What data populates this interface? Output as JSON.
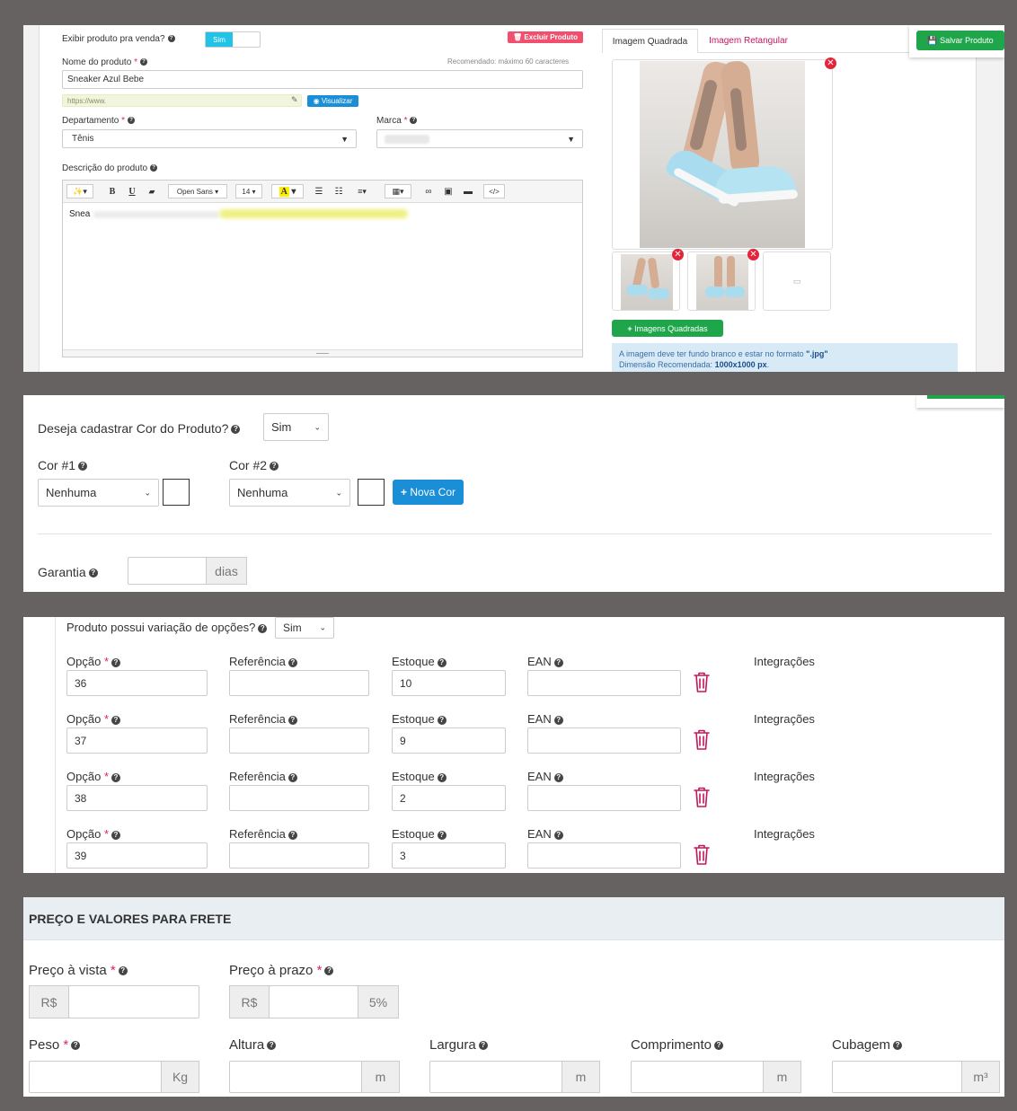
{
  "top": {
    "exibir_label": "Exibir produto pra venda?",
    "exibir_toggle": "Sim",
    "excluir_button": "Excluir Produto",
    "nome_label": "Nome do produto",
    "nome_hint": "Recomendado: máximo 60 caracteres",
    "nome_value": "Sneaker Azul Bebe",
    "url_value": "https://www.",
    "visualizar_button": "Visualizar",
    "departamento_label": "Departamento",
    "departamento_value": "Tênis",
    "marca_label": "Marca",
    "descricao_label": "Descrição do produto",
    "editor": {
      "font_name": "Open Sans",
      "font_size": "14",
      "content": "Snea"
    },
    "tabs": [
      "Imagem Quadrada",
      "Imagem Retangular"
    ],
    "salvar_button": "Salvar Produto",
    "add_images_button": "Imagens Quadradas",
    "info_text_1": "A imagem deve ter fundo branco e estar no formato ",
    "info_format": "\".jpg\"",
    "info_text_2": "Dimensão Recomendada: ",
    "info_dimension": "1000x1000 px",
    "info_dot": "."
  },
  "colors_section": {
    "question": "Deseja cadastrar Cor do Produto?",
    "question_value": "Sim",
    "cor1_label": "Cor #1",
    "cor1_value": "Nenhuma",
    "cor2_label": "Cor #2",
    "cor2_value": "Nenhuma",
    "nova_cor_button": "Nova Cor",
    "garantia_label": "Garantia",
    "garantia_unit": "dias"
  },
  "variations": {
    "question": "Produto possui variação de opções?",
    "question_value": "Sim",
    "headers": {
      "opcao": "Opção",
      "referencia": "Referência",
      "estoque": "Estoque",
      "ean": "EAN",
      "integracoes": "Integrações"
    },
    "rows": [
      {
        "opcao": "36",
        "estoque": "10"
      },
      {
        "opcao": "37",
        "estoque": "9"
      },
      {
        "opcao": "38",
        "estoque": "2"
      },
      {
        "opcao": "39",
        "estoque": "3"
      }
    ]
  },
  "pricing": {
    "section_title": "PREÇO E VALORES PARA FRETE",
    "preco_vista_label": "Preço à vista",
    "preco_prazo_label": "Preço à prazo",
    "currency": "R$",
    "percent": "5%",
    "peso_label": "Peso",
    "peso_unit": "Kg",
    "altura_label": "Altura",
    "largura_label": "Largura",
    "comprimento_label": "Comprimento",
    "cubagem_label": "Cubagem",
    "meter_unit": "m",
    "cubic_unit": "m³"
  },
  "colors": {
    "green": "#1fa64a",
    "red": "#e0245e",
    "blue": "#1a8fd8",
    "cyan": "#22c3e6",
    "trash": "#c2185b"
  }
}
